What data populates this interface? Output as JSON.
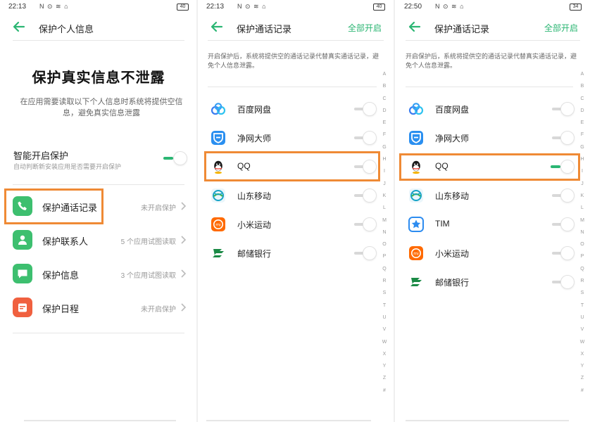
{
  "panels": [
    {
      "status": {
        "time": "22:13",
        "icons": "N ⊙ ≋ ⌂",
        "battery": "40"
      },
      "title": "保护个人信息",
      "heading": "保护真实信息不泄露",
      "description": "在应用需要读取以下个人信息时系统将提供空信息，避免真实信息泄露",
      "smart": {
        "label": "智能开启保护",
        "sub": "自动判断新安装应用是否需要开启保护",
        "on": true
      },
      "items": [
        {
          "icon": "phone-icon",
          "color": "#3dbf6f",
          "label": "保护通话记录",
          "status": "未开启保护"
        },
        {
          "icon": "contact-icon",
          "color": "#3dbf6f",
          "label": "保护联系人",
          "status": "5 个应用试图读取"
        },
        {
          "icon": "message-icon",
          "color": "#3dbf6f",
          "label": "保护信息",
          "status": "3 个应用试图读取"
        },
        {
          "icon": "calendar-icon",
          "color": "#f0603f",
          "label": "保护日程",
          "status": "未开启保护"
        }
      ]
    },
    {
      "status": {
        "time": "22:13",
        "icons": "N ⊙ ≋ ⌂",
        "battery": "40"
      },
      "title": "保护通话记录",
      "all_on": "全部开启",
      "hint": "开启保护后，系统将提供空的通话记录代替真实通话记录，避免个人信息泄露。",
      "apps": [
        {
          "icon": "baidu-netdisk-icon",
          "label": "百度网盘",
          "on": false
        },
        {
          "icon": "jingwang-icon",
          "label": "净网大师",
          "on": false
        },
        {
          "icon": "qq-icon",
          "label": "QQ",
          "on": false
        },
        {
          "icon": "china-mobile-icon",
          "label": "山东移动",
          "on": false
        },
        {
          "icon": "xiaomi-sport-icon",
          "label": "小米运动",
          "on": false
        },
        {
          "icon": "postal-bank-icon",
          "label": "邮储银行",
          "on": false
        }
      ]
    },
    {
      "status": {
        "time": "22:50",
        "icons": "N ⊙ ≋ ⌂",
        "battery": "34"
      },
      "title": "保护通话记录",
      "all_on": "全部开启",
      "hint": "开启保护后，系统将提供空的通话记录代替真实通话记录，避免个人信息泄露。",
      "apps": [
        {
          "icon": "baidu-netdisk-icon",
          "label": "百度网盘",
          "on": false
        },
        {
          "icon": "jingwang-icon",
          "label": "净网大师",
          "on": false
        },
        {
          "icon": "qq-icon",
          "label": "QQ",
          "on": true
        },
        {
          "icon": "china-mobile-icon",
          "label": "山东移动",
          "on": false
        },
        {
          "icon": "tim-icon",
          "label": "TIM",
          "on": false
        },
        {
          "icon": "xiaomi-sport-icon",
          "label": "小米运动",
          "on": false
        },
        {
          "icon": "postal-bank-icon",
          "label": "邮储银行",
          "on": false
        }
      ]
    }
  ],
  "alphabet": [
    "A",
    "B",
    "C",
    "D",
    "E",
    "F",
    "G",
    "H",
    "I",
    "J",
    "K",
    "L",
    "M",
    "N",
    "O",
    "P",
    "Q",
    "R",
    "S",
    "T",
    "U",
    "V",
    "W",
    "X",
    "Y",
    "Z",
    "#"
  ],
  "colors": {
    "accent": "#2bb673",
    "highlight": "#ef8a35"
  }
}
